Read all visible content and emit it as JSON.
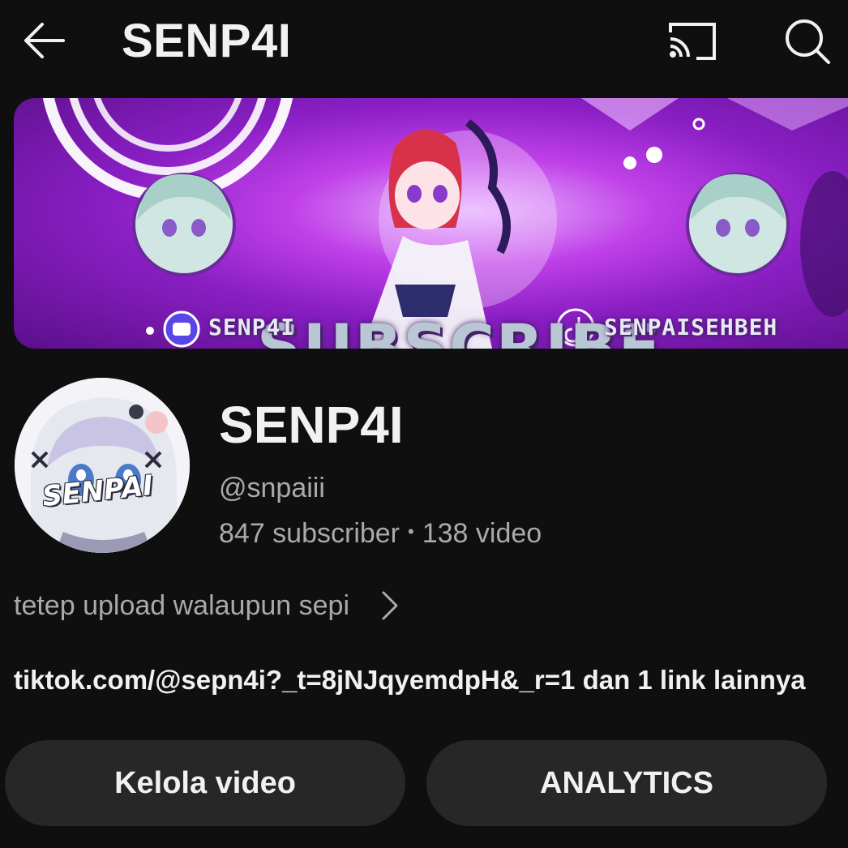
{
  "topbar": {
    "title": "SENP4I",
    "back_icon": "arrow-left-icon",
    "cast_icon": "cast-icon",
    "search_icon": "search-icon"
  },
  "banner": {
    "headline": "SUBSCRIBE",
    "left_handle": "SENP4I",
    "right_handle": "SENPAISEHBEH"
  },
  "channel": {
    "avatar_text": "SENPAI",
    "name": "SENP4I",
    "handle": "@snpaiii",
    "subscribers": "847 subscriber",
    "separator": "•",
    "videos": "138 video",
    "description": "tetep upload walaupun sepi",
    "links": "tiktok.com/@sepn4i?_t=8jNJqyemdpH&_r=1 dan 1 link lainnya"
  },
  "actions": {
    "manage_label": "Kelola video",
    "analytics_label": "ANALYTICS"
  },
  "colors": {
    "background": "#0f0f0f",
    "button_bg": "#272727",
    "secondary_text": "#aaaaaa",
    "banner_accent": "#a020d8"
  }
}
